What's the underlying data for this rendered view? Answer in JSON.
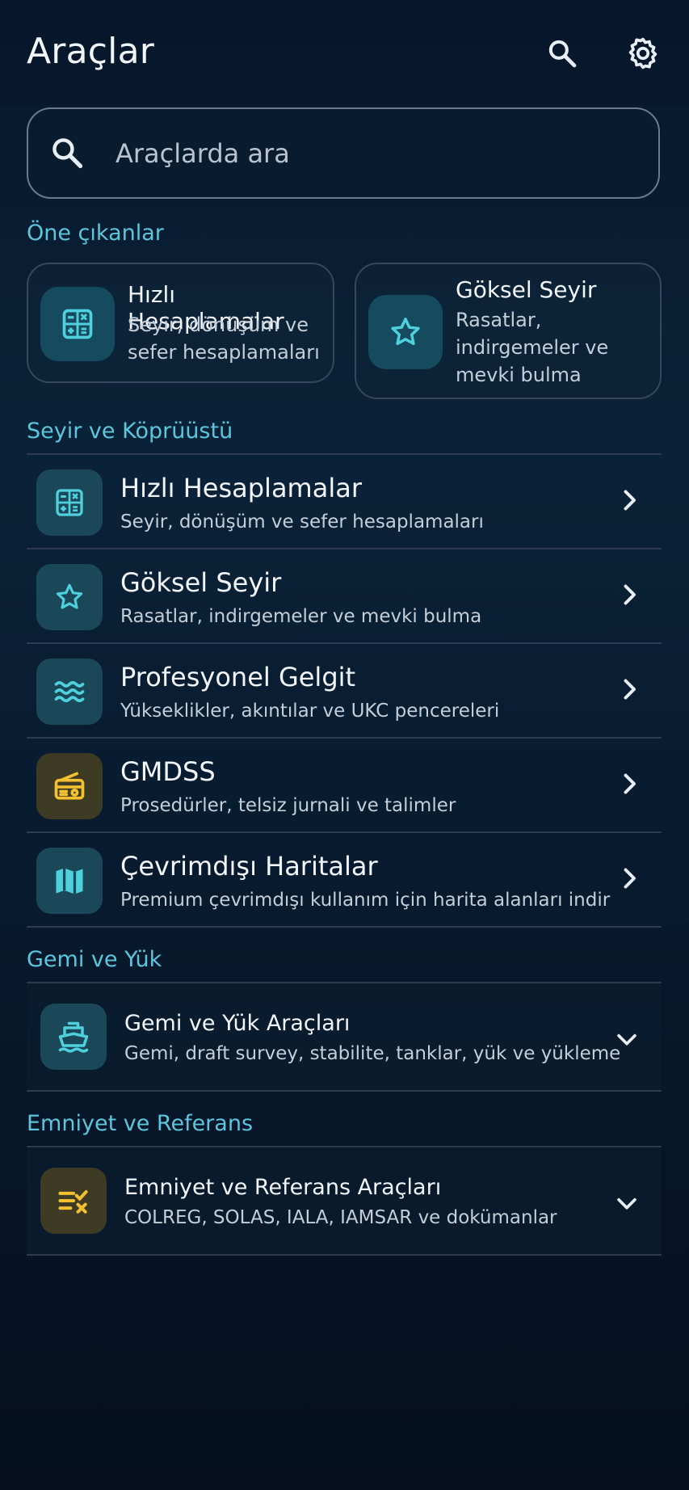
{
  "header": {
    "title": "Araçlar",
    "search_icon": "search-icon",
    "settings_icon": "gear-icon"
  },
  "search": {
    "placeholder": "Araçlarda ara",
    "value": ""
  },
  "featured": {
    "heading": "Öne çıkanlar",
    "cards": [
      {
        "title": "Hızlı Hesaplamalar",
        "desc_line1": "Seyir, dönüşüm ve",
        "desc_line2": "sefer hesaplamaları",
        "icon": "calculator-icon"
      },
      {
        "title": "Göksel Seyir",
        "desc_line1": "Rasatlar,",
        "desc_line2": "indirgemeler ve",
        "desc_line3": "mevki bulma",
        "icon": "star-icon"
      }
    ]
  },
  "navigation": {
    "heading": "Seyir ve Köprüüstü",
    "items": [
      {
        "title": "Hızlı Hesaplamalar",
        "desc": "Seyir, dönüşüm ve sefer hesaplamaları",
        "icon": "calculator-icon"
      },
      {
        "title": "Göksel Seyir",
        "desc": "Rasatlar, indirgemeler ve mevki bulma",
        "icon": "star-icon"
      },
      {
        "title": "Profesyonel Gelgit",
        "desc": "Yükseklikler, akıntılar ve UKC pencereleri",
        "icon": "waves-icon"
      },
      {
        "title": "GMDSS",
        "desc": "Prosedürler, telsiz jurnali ve talimler",
        "icon": "radio-icon"
      },
      {
        "title": "Çevrimdışı Haritalar",
        "desc": "Premium çevrimdışı kullanım için harita alanları indir",
        "icon": "map-icon"
      }
    ]
  },
  "ship_cargo": {
    "heading": "Gemi ve Yük",
    "title": "Gemi ve Yük Araçları",
    "desc": "Gemi, draft survey, stabilite, tanklar, yük ve yükleme",
    "icon": "ship-icon"
  },
  "safety": {
    "heading": "Emniyet ve Referans",
    "title": "Emniyet ve Referans Araçları",
    "desc": "COLREG, SOLAS, IALA, IAMSAR ve dokümanlar",
    "icon": "checklist-icon"
  },
  "colors": {
    "accent": "#5cc6dc",
    "icon_teal": "#4fd0dd",
    "icon_gold": "#f2c030",
    "background": "#07182b"
  }
}
